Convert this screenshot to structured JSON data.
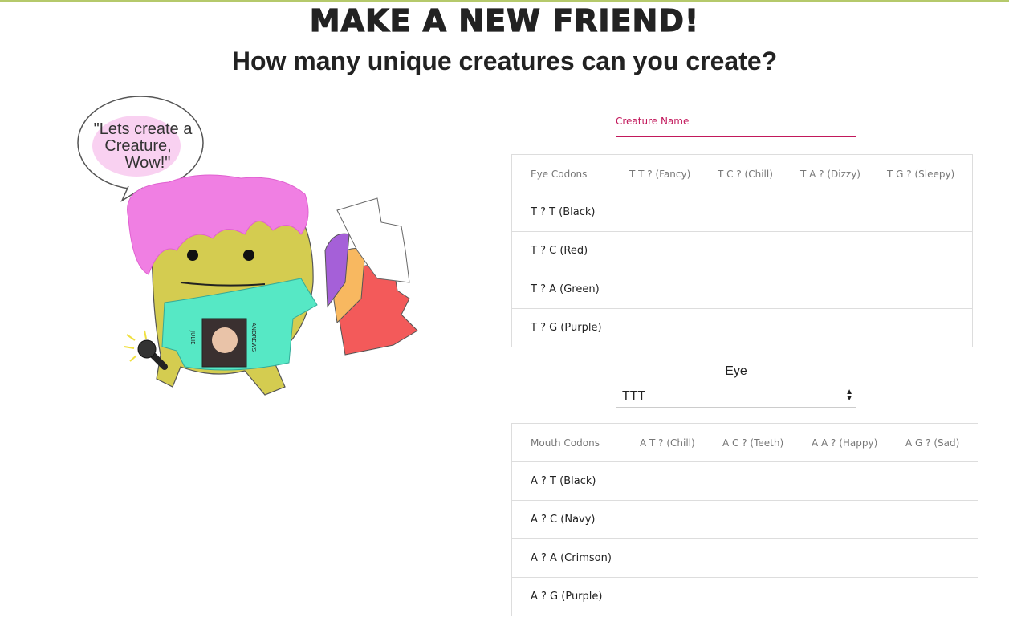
{
  "header": {
    "title": "MAKE A NEW FRIEND!",
    "subtitle": "How many unique creatures can you create?"
  },
  "creature": {
    "speech_line1": "\"Lets create a",
    "speech_line2": "Creature,",
    "speech_line3": "Wow!\"",
    "shirt_text_left": "JULIE",
    "shirt_text_right": "ANDREWS"
  },
  "name_field": {
    "label": "Creature Name",
    "value": ""
  },
  "eye_table": {
    "headers": [
      "Eye Codons",
      "T T ? (Fancy)",
      "T C ? (Chill)",
      "T A ? (Dizzy)",
      "T G ? (Sleepy)"
    ],
    "rows": [
      "T ? T (Black)",
      "T ? C (Red)",
      "T ? A (Green)",
      "T ? G (Purple)"
    ]
  },
  "eye_select": {
    "label": "Eye",
    "value": "TTT"
  },
  "mouth_table": {
    "headers": [
      "Mouth Codons",
      "A T ? (Chill)",
      "A C ? (Teeth)",
      "A A ? (Happy)",
      "A G ? (Sad)"
    ],
    "rows": [
      "A ? T (Black)",
      "A ? C (Navy)",
      "A ? A (Crimson)",
      "A ? G (Purple)"
    ]
  },
  "colors": {
    "accent": "#c2185b",
    "top_rule": "#b5c96b",
    "creature_body": "#d4cc50",
    "hair": "#f07fe3",
    "shirt": "#56e8c5"
  }
}
